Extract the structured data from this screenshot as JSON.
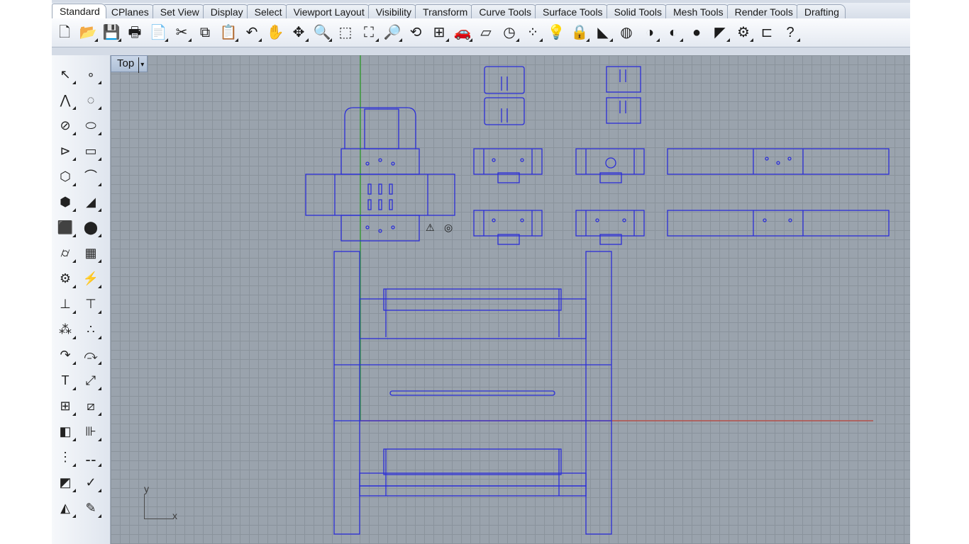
{
  "tabs": [
    "Standard",
    "CPlanes",
    "Set View",
    "Display",
    "Select",
    "Viewport Layout",
    "Visibility",
    "Transform",
    "Curve Tools",
    "Surface Tools",
    "Solid Tools",
    "Mesh Tools",
    "Render Tools",
    "Drafting"
  ],
  "active_tab": "Standard",
  "toolbar_icons": [
    {
      "name": "new-file-icon",
      "glyph": "🗋"
    },
    {
      "name": "open-folder-icon",
      "glyph": "📂"
    },
    {
      "name": "save-icon",
      "glyph": "💾"
    },
    {
      "name": "print-icon",
      "glyph": "🖶"
    },
    {
      "name": "paste-doc-icon",
      "glyph": "📄"
    },
    {
      "name": "cut-icon",
      "glyph": "✂"
    },
    {
      "name": "copy-icon",
      "glyph": "⧉"
    },
    {
      "name": "clipboard-icon",
      "glyph": "📋"
    },
    {
      "name": "undo-icon",
      "glyph": "↶"
    },
    {
      "name": "pan-hand-icon",
      "glyph": "✋"
    },
    {
      "name": "move-view-icon",
      "glyph": "✥"
    },
    {
      "name": "zoom-icon",
      "glyph": "🔍"
    },
    {
      "name": "zoom-window-icon",
      "glyph": "⬚"
    },
    {
      "name": "zoom-extents-icon",
      "glyph": "⛶"
    },
    {
      "name": "zoom-selected-icon",
      "glyph": "🔎"
    },
    {
      "name": "rotate-view-icon",
      "glyph": "⟲"
    },
    {
      "name": "four-viewports-icon",
      "glyph": "⊞"
    },
    {
      "name": "car-icon",
      "glyph": "🚗"
    },
    {
      "name": "layers-icon",
      "glyph": "▱"
    },
    {
      "name": "clock-icon",
      "glyph": "◷"
    },
    {
      "name": "points-icon",
      "glyph": "⁘"
    },
    {
      "name": "light-bulb-icon",
      "glyph": "💡"
    },
    {
      "name": "lock-icon",
      "glyph": "🔒"
    },
    {
      "name": "material-icon",
      "glyph": "◣"
    },
    {
      "name": "color-wheel-icon",
      "glyph": "◍"
    },
    {
      "name": "shaded-sphere-icon",
      "glyph": "◑"
    },
    {
      "name": "rendered-sphere-icon",
      "glyph": "◐"
    },
    {
      "name": "blue-sphere-icon",
      "glyph": "●"
    },
    {
      "name": "render-icon",
      "glyph": "◤"
    },
    {
      "name": "settings-gear-icon",
      "glyph": "⚙"
    },
    {
      "name": "dimension-icon",
      "glyph": "⊏"
    },
    {
      "name": "help-icon",
      "glyph": "?"
    }
  ],
  "sidebar_icons": [
    [
      "select-arrow-icon",
      "↖"
    ],
    [
      "point-icon",
      "∘"
    ],
    [
      "polyline-icon",
      "⋀"
    ],
    [
      "curve-icon",
      "◌"
    ],
    [
      "circle-icon",
      "⊘"
    ],
    [
      "ellipse-icon",
      "⬭"
    ],
    [
      "arc-icon",
      "⊳"
    ],
    [
      "rectangle-icon",
      "▭"
    ],
    [
      "polygon-icon",
      "⬡"
    ],
    [
      "fillet-curve-icon",
      "⌒"
    ],
    [
      "surface-icon",
      "⬢"
    ],
    [
      "loft-icon",
      "◢"
    ],
    [
      "box-icon",
      "⬛"
    ],
    [
      "spheres-icon",
      "⬤"
    ],
    [
      "cylinder-icon",
      "⌭"
    ],
    [
      "mesh-plane-icon",
      "▦"
    ],
    [
      "boolean-gear-icon",
      "⚙"
    ],
    [
      "explode-icon",
      "⚡"
    ],
    [
      "trim-icon",
      "⊥"
    ],
    [
      "split-icon",
      "⊤"
    ],
    [
      "group-icon",
      "⁂"
    ],
    [
      "ungroup-icon",
      "∴"
    ],
    [
      "offset-icon",
      "↷"
    ],
    [
      "blend-icon",
      "⤼"
    ],
    [
      "text-icon",
      "T"
    ],
    [
      "dimension-tool-icon",
      "⤢"
    ],
    [
      "array-icon",
      "⊞"
    ],
    [
      "transform-icon",
      "⧄"
    ],
    [
      "solid-box-icon",
      "◧"
    ],
    [
      "ruler-icon",
      "⊪"
    ],
    [
      "grid-array-icon",
      "⋮"
    ],
    [
      "mirror-icon",
      "⚋"
    ],
    [
      "project-icon",
      "◩"
    ],
    [
      "check-icon",
      "✓"
    ],
    [
      "analyze-icon",
      "◭"
    ],
    [
      "pen-icon",
      "✎"
    ]
  ],
  "viewport": {
    "label": "Top",
    "dropdown": "▾",
    "axis_y": "y",
    "axis_x": "x"
  },
  "colors": {
    "geometry": "#2b2ed8",
    "grid": "#8a939c",
    "grid_bg": "#9aa3ad",
    "x_axis": "#b3504a",
    "y_axis": "#3a9a3a"
  }
}
